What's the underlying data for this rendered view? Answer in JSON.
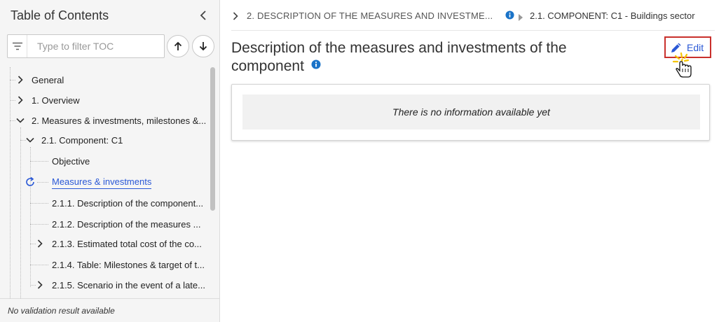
{
  "sidebar": {
    "title": "Table of Contents",
    "filter_placeholder": "Type to filter TOC",
    "footer_text": "No validation result available",
    "items": [
      {
        "label": "General"
      },
      {
        "label": "1. Overview"
      },
      {
        "label": "2. Measures & investments, milestones &..."
      },
      {
        "label": "2.1. Component: C1"
      },
      {
        "label": "Objective"
      },
      {
        "label": "Measures & investments"
      },
      {
        "label": "2.1.1. Description of the component..."
      },
      {
        "label": "2.1.2. Description of the measures ..."
      },
      {
        "label": "2.1.3. Estimated total cost of the co..."
      },
      {
        "label": "2.1.4. Table: Milestones & target of t..."
      },
      {
        "label": "2.1.5. Scenario in the event of a late..."
      }
    ]
  },
  "breadcrumb": {
    "item1": "2. DESCRIPTION OF THE MEASURES AND INVESTME...",
    "item2": "2.1. COMPONENT: C1 - Buildings sector"
  },
  "main": {
    "title": "Description of the measures and investments of the component",
    "edit_label": "Edit",
    "empty_message": "There is no information available yet"
  },
  "colors": {
    "accent_blue": "#2a58d6",
    "info_blue": "#1a73c8",
    "highlight_red": "#c9302c"
  }
}
